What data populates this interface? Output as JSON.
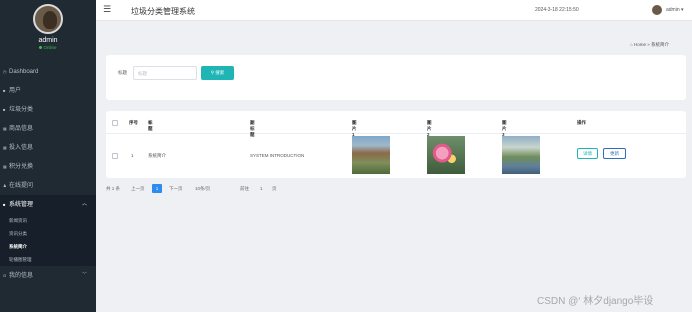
{
  "sidebar": {
    "username": "admin",
    "status": "Online",
    "items": [
      {
        "label": "Dashboard",
        "icon": "dashboard-icon"
      },
      {
        "label": "用户",
        "icon": "user-icon"
      },
      {
        "label": "垃圾分类",
        "icon": "category-icon"
      },
      {
        "label": "商品信息",
        "icon": "grid-icon"
      },
      {
        "label": "投入信息",
        "icon": "grid-icon"
      },
      {
        "label": "积分兑换",
        "icon": "grid-icon"
      },
      {
        "label": "在线提问",
        "icon": "person-icon"
      },
      {
        "label": "系统管理",
        "icon": "grid-icon"
      },
      {
        "label": "我的信息",
        "icon": "info-icon"
      }
    ],
    "sub_items": [
      "新闻资讯",
      "资讯分类",
      "系统简介",
      "轮播图管理"
    ]
  },
  "header": {
    "title": "垃圾分类管理系统",
    "datetime": "2024-3-18 22:15:50",
    "user": "admin"
  },
  "breadcrumb": {
    "home": "Home",
    "separator": "»",
    "current": "系统简介"
  },
  "search": {
    "label": "标题",
    "placeholder": "标题",
    "button_label": "搜索"
  },
  "table": {
    "columns": [
      "序号",
      "标题",
      "副标题",
      "图片1",
      "图片2",
      "图片3",
      "操作"
    ],
    "rows": [
      {
        "index": "1",
        "title": "系统简介",
        "subtitle": "SYSTEM INTRODUCTION"
      }
    ],
    "action_detail": "详情",
    "action_edit": "更新"
  },
  "pager": {
    "total": "共 1 条",
    "prev": "上一页",
    "current_page": "1",
    "next": "下一页",
    "page_size": "10条/页",
    "goto_label": "前往",
    "goto_value": "1",
    "page_unit": "页"
  },
  "watermark": "CSDN @‘ 林夕django毕设",
  "colors": {
    "sidebar_bg": "#1f2a33",
    "accent": "#1fb5b5",
    "primary": "#2d8cf0"
  }
}
